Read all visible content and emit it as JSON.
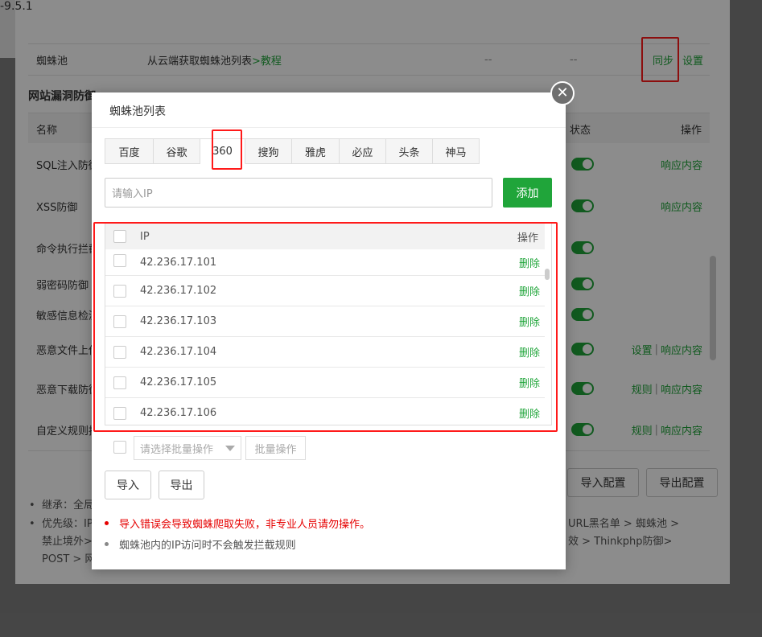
{
  "background": {
    "version_text": "-9.5.1",
    "spider_row": {
      "name": "蜘蛛池",
      "desc_prefix": "从云端获取蜘蛛池列表 ",
      "tutorial_link": ">教程",
      "col3": "--",
      "col4": "--",
      "sync": "同步",
      "settings": "设置"
    },
    "section_title": "网站漏洞防御",
    "table_header": {
      "name": "名称",
      "status": "状态",
      "action": "操作"
    },
    "rows": [
      {
        "name": "SQL注入防御",
        "action1": "",
        "action2": "响应内容"
      },
      {
        "name": "XSS防御",
        "action1": "",
        "action2": "响应内容"
      },
      {
        "name": "命令执行拦截",
        "action1": "",
        "action2": ""
      },
      {
        "name": "弱密码防御",
        "action1": "",
        "action2": ""
      },
      {
        "name": "敏感信息检测",
        "action1": "",
        "action2": ""
      },
      {
        "name": "恶意文件上传",
        "action1": "设置",
        "action2": "响应内容"
      },
      {
        "name": "恶意下载防御",
        "action1": "规则",
        "action2": "响应内容"
      },
      {
        "name": "自定义规则拦截",
        "action1": "规则",
        "action2": "响应内容"
      }
    ],
    "import_config": "导入配置",
    "export_config": "导出配置",
    "notes": {
      "inherit": "继承：全局",
      "priority_prefix": "优先级：IP",
      "priority_right": "URL黑名单 > 蜘蛛池 >",
      "line2_left": "禁止境外>",
      "line2_right": "效 > Thinkphp防御>",
      "line3_left": "POST > 网"
    }
  },
  "modal": {
    "title": "蜘蛛池列表",
    "close_symbol": "✕",
    "tabs": [
      "百度",
      "谷歌",
      "360",
      "搜狗",
      "雅虎",
      "必应",
      "头条",
      "神马"
    ],
    "active_tab": "360",
    "input_placeholder": "请输入IP",
    "add_label": "添加",
    "list_header": {
      "ip": "IP",
      "action": "操作"
    },
    "rows": [
      {
        "ip": "42.236.17.101",
        "action": "删除"
      },
      {
        "ip": "42.236.17.102",
        "action": "删除"
      },
      {
        "ip": "42.236.17.103",
        "action": "删除"
      },
      {
        "ip": "42.236.17.104",
        "action": "删除"
      },
      {
        "ip": "42.236.17.105",
        "action": "删除"
      },
      {
        "ip": "42.236.17.106",
        "action": "删除"
      }
    ],
    "batch_select_placeholder": "请选择批量操作",
    "batch_button": "批量操作",
    "import_label": "导入",
    "export_label": "导出",
    "warning": "导入错误会导致蜘蛛爬取失败，非专业人员请勿操作。",
    "info": "蜘蛛池内的IP访问时不会触发拦截规则"
  },
  "colors": {
    "accent": "#20a53a",
    "warning": "#e60000",
    "highlight": "#ff1a1a"
  }
}
